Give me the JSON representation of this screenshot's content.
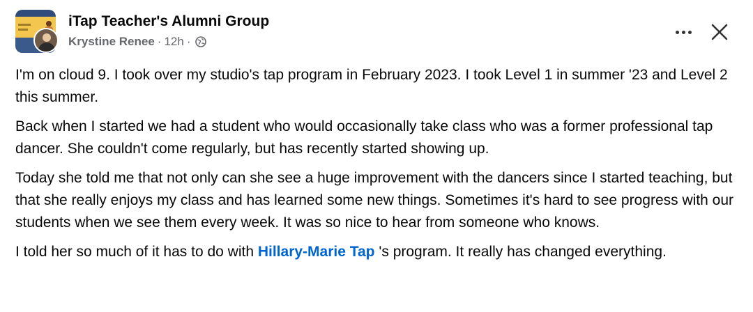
{
  "header": {
    "group_name": "iTap Teacher's Alumni Group",
    "author": "Krystine Renee",
    "separator": "·",
    "timestamp": "12h",
    "audience_icon": "globe-icon"
  },
  "actions": {
    "more_icon": "more-horizontal-icon",
    "close_icon": "close-icon"
  },
  "post": {
    "p1": "I'm on cloud 9. I took over my studio's tap program in February 2023. I took Level 1 in summer '23 and Level 2 this summer.",
    "p2": "Back when I started we had a student who would occasionally take class who was a former professional tap dancer. She couldn't come regularly, but has recently started showing up.",
    "p3": "Today she told me that not only can she see a huge improvement with the dancers since I started teaching, but that she really enjoys my class and has learned some new things. Sometimes it's hard to see progress with our students when we see them every week. It was so nice to hear from someone who knows.",
    "p4_before": "I told her so much of it has to do with ",
    "p4_mention": "Hillary-Marie Tap",
    "p4_after": " 's program. It really has changed everything."
  },
  "colors": {
    "mention": "#0064d1",
    "secondary_text": "#65676b",
    "primary_text": "#080809"
  }
}
